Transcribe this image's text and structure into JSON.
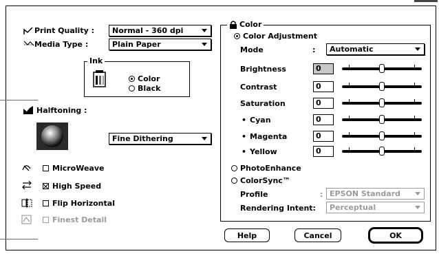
{
  "left": {
    "print_quality": {
      "label": "Print Quality :",
      "value": "Normal - 360 dpi"
    },
    "media_type": {
      "label": "Media Type :",
      "value": "Plain Paper"
    },
    "ink": {
      "title": "Ink",
      "options": [
        "Color",
        "Black"
      ],
      "selected": "Color"
    },
    "halftoning": {
      "label": "Halftoning :",
      "value": "Fine Dithering"
    },
    "checkboxes": [
      {
        "label": "MicroWeave",
        "checked": false,
        "enabled": true
      },
      {
        "label": "High Speed",
        "checked": true,
        "enabled": true
      },
      {
        "label": "Flip Horizontal",
        "checked": false,
        "enabled": true
      },
      {
        "label": "Finest Detail",
        "checked": false,
        "enabled": false
      }
    ]
  },
  "color": {
    "title": "Color",
    "adjustment_label": "Color Adjustment",
    "mode_label": "Mode",
    "mode_value": "Automatic",
    "sliders": [
      {
        "label": "Brightness",
        "value": "0"
      },
      {
        "label": "Contrast",
        "value": "0"
      },
      {
        "label": "Saturation",
        "value": "0"
      },
      {
        "label": "Cyan",
        "value": "0"
      },
      {
        "label": "Magenta",
        "value": "0"
      },
      {
        "label": "Yellow",
        "value": "0"
      }
    ],
    "photo_enhance_label": "PhotoEnhance",
    "colorsync_label": "ColorSync™",
    "profile_label": "Profile",
    "profile_value": "EPSON Standard",
    "rendering_label": "Rendering Intent:",
    "rendering_value": "Perceptual"
  },
  "buttons": {
    "help": "Help",
    "cancel": "Cancel",
    "ok": "OK"
  }
}
